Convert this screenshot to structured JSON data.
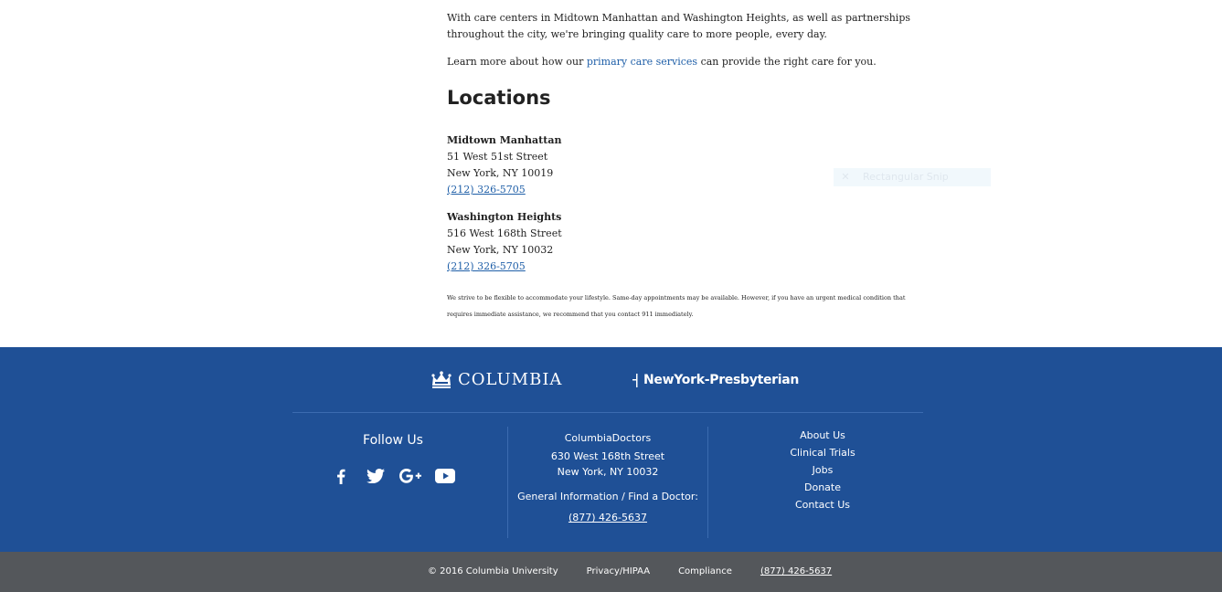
{
  "intro": {
    "paragraph": "With care centers in Midtown Manhattan and Washington Heights, as well as partnerships throughout the city, we're bringing quality care to more people, every day.",
    "learn_prefix": "Learn more about how our ",
    "learn_link": "primary care services",
    "learn_suffix": " can provide the right care for you."
  },
  "locations": {
    "heading": "Locations",
    "items": [
      {
        "name": "Midtown Manhattan",
        "street": "51 West 51st Street",
        "city": "New York, NY 10019",
        "phone": "(212) 326-5705"
      },
      {
        "name": "Washington Heights",
        "street": "516 West 168th Street",
        "city": "New York, NY 10032",
        "phone": "(212) 326-5705"
      }
    ],
    "disclaimer": "We strive to be flexible to accommodate your lifestyle. Same-day appointments may be available. However, if you have an urgent medical condition that requires immediate assistance, we recommend that you contact 911 immediately."
  },
  "overlay": {
    "label": "Rectangular Snip",
    "icon": "close-icon"
  },
  "footer": {
    "logo_columbia": "COLUMBIA",
    "logo_nyp": "NewYork-Presbyterian",
    "follow_title": "Follow Us",
    "social": [
      {
        "name": "facebook-icon"
      },
      {
        "name": "twitter-icon"
      },
      {
        "name": "google-plus-icon"
      },
      {
        "name": "youtube-icon"
      }
    ],
    "contact": {
      "name": "ColumbiaDoctors",
      "street": "630 West 168th Street",
      "city": "New York, NY 10032",
      "general": "General Information / Find a Doctor:",
      "phone": "(877) 426-5637"
    },
    "links": [
      "About Us",
      "Clinical Trials",
      "Jobs",
      "Donate",
      "Contact Us"
    ]
  },
  "bottom_bar": {
    "copyright": "© 2016 Columbia University",
    "privacy": "Privacy/HIPAA",
    "compliance": "Compliance",
    "phone": "(877) 426-5637"
  },
  "colors": {
    "footer_bg": "#1f5096",
    "bottom_bar_bg": "#54575b",
    "link": "#1f5fa8"
  }
}
